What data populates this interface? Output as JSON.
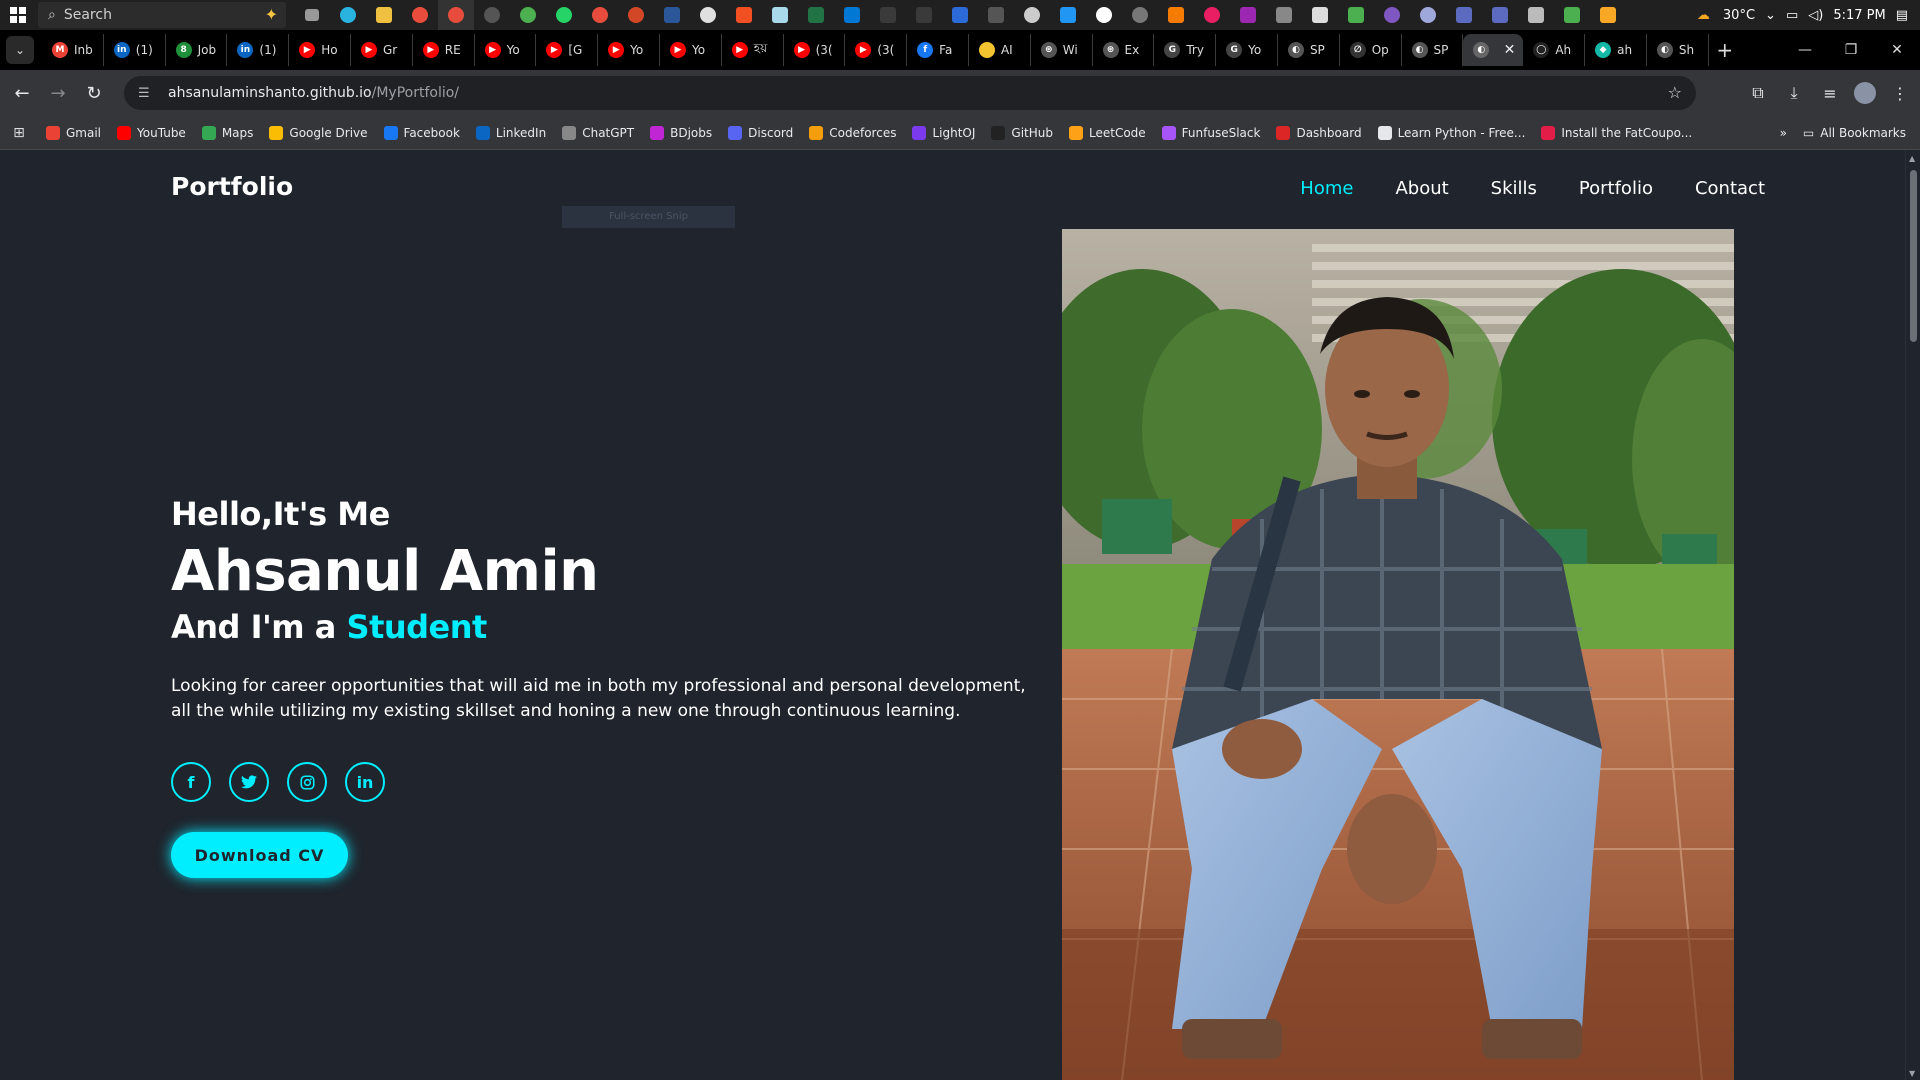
{
  "taskbar": {
    "search_placeholder": "Search",
    "weather": "30°C",
    "time": "5:17 PM"
  },
  "tabs": [
    {
      "label": "Inb",
      "fav_color": "#ea4335",
      "fav_text": "M"
    },
    {
      "label": "(1)",
      "fav_color": "#0a66c2",
      "fav_text": "in"
    },
    {
      "label": "Job",
      "fav_color": "#1f8f3a",
      "fav_text": "8"
    },
    {
      "label": "(1)",
      "fav_color": "#0a66c2",
      "fav_text": "in"
    },
    {
      "label": "Ho",
      "fav_color": "#ff0000",
      "fav_text": "▶"
    },
    {
      "label": "Gr",
      "fav_color": "#ff0000",
      "fav_text": "▶"
    },
    {
      "label": "RE",
      "fav_color": "#ff0000",
      "fav_text": "▶"
    },
    {
      "label": "Yo",
      "fav_color": "#ff0000",
      "fav_text": "▶"
    },
    {
      "label": "[G",
      "fav_color": "#ff0000",
      "fav_text": "▶"
    },
    {
      "label": "Yo",
      "fav_color": "#ff0000",
      "fav_text": "▶"
    },
    {
      "label": "Yo",
      "fav_color": "#ff0000",
      "fav_text": "▶"
    },
    {
      "label": "হয়",
      "fav_color": "#ff0000",
      "fav_text": "▶"
    },
    {
      "label": "(3(",
      "fav_color": "#ff0000",
      "fav_text": "▶"
    },
    {
      "label": "(3(",
      "fav_color": "#ff0000",
      "fav_text": "▶"
    },
    {
      "label": "Fa",
      "fav_color": "#1877f2",
      "fav_text": "f"
    },
    {
      "label": "AI",
      "fav_color": "#f4c430",
      "fav_text": ""
    },
    {
      "label": "Wi",
      "fav_color": "#555555",
      "fav_text": "⊛"
    },
    {
      "label": "Ex",
      "fav_color": "#555555",
      "fav_text": "⊛"
    },
    {
      "label": "Try",
      "fav_color": "#444444",
      "fav_text": "G"
    },
    {
      "label": "Yo",
      "fav_color": "#444444",
      "fav_text": "G"
    },
    {
      "label": "SP",
      "fav_color": "#555555",
      "fav_text": "◐"
    },
    {
      "label": "Op",
      "fav_color": "#333333",
      "fav_text": "∅"
    },
    {
      "label": "SP",
      "fav_color": "#555555",
      "fav_text": "◐"
    },
    {
      "label": "",
      "fav_color": "#666666",
      "fav_text": "◐",
      "active": true
    },
    {
      "label": "Ah",
      "fav_color": "#222222",
      "fav_text": "◯"
    },
    {
      "label": "ah",
      "fav_color": "#14b8a6",
      "fav_text": "◆"
    },
    {
      "label": "Sh",
      "fav_color": "#555555",
      "fav_text": "◐"
    }
  ],
  "address": {
    "domain": "ahsanulaminshanto.github.io",
    "path": "/MyPortfolio/"
  },
  "bookmarks": [
    {
      "label": "Gmail",
      "color": "#ea4335"
    },
    {
      "label": "YouTube",
      "color": "#ff0000"
    },
    {
      "label": "Maps",
      "color": "#34a853"
    },
    {
      "label": "Google Drive",
      "color": "#fbbc04"
    },
    {
      "label": "Facebook",
      "color": "#1877f2"
    },
    {
      "label": "LinkedIn",
      "color": "#0a66c2"
    },
    {
      "label": "ChatGPT",
      "color": "#888888"
    },
    {
      "label": "BDjobs",
      "color": "#c026d3"
    },
    {
      "label": "Discord",
      "color": "#5865f2"
    },
    {
      "label": "Codeforces",
      "color": "#f59e0b"
    },
    {
      "label": "LightOJ",
      "color": "#7c3aed"
    },
    {
      "label": "GitHub",
      "color": "#222222"
    },
    {
      "label": "LeetCode",
      "color": "#ffa116"
    },
    {
      "label": "FunfuseSlack",
      "color": "#a855f7"
    },
    {
      "label": "Dashboard",
      "color": "#dc2626"
    },
    {
      "label": "Learn Python - Free...",
      "color": "#e5e7eb"
    },
    {
      "label": "Install the FatCoupo...",
      "color": "#e11d48"
    }
  ],
  "bookmarks_all": "All Bookmarks",
  "site": {
    "logo": "Portfolio",
    "nav": [
      "Home",
      "About",
      "Skills",
      "Portfolio",
      "Contact"
    ],
    "snip_label": "Full-screen Snip",
    "greeting": "Hello,It's Me",
    "name": "Ahsanul Amin",
    "role_prefix": "And I'm a ",
    "role": "Student",
    "about": "Looking for career opportunities that will aid me in both my professional and personal development, all the while utilizing my existing skillset and honing a new one through continuous learning.",
    "socials": [
      "facebook-icon",
      "twitter-icon",
      "instagram-icon",
      "linkedin-icon"
    ],
    "cv_button": "Download CV",
    "accent_color": "#00eeff",
    "bg_color": "#1f242d"
  }
}
